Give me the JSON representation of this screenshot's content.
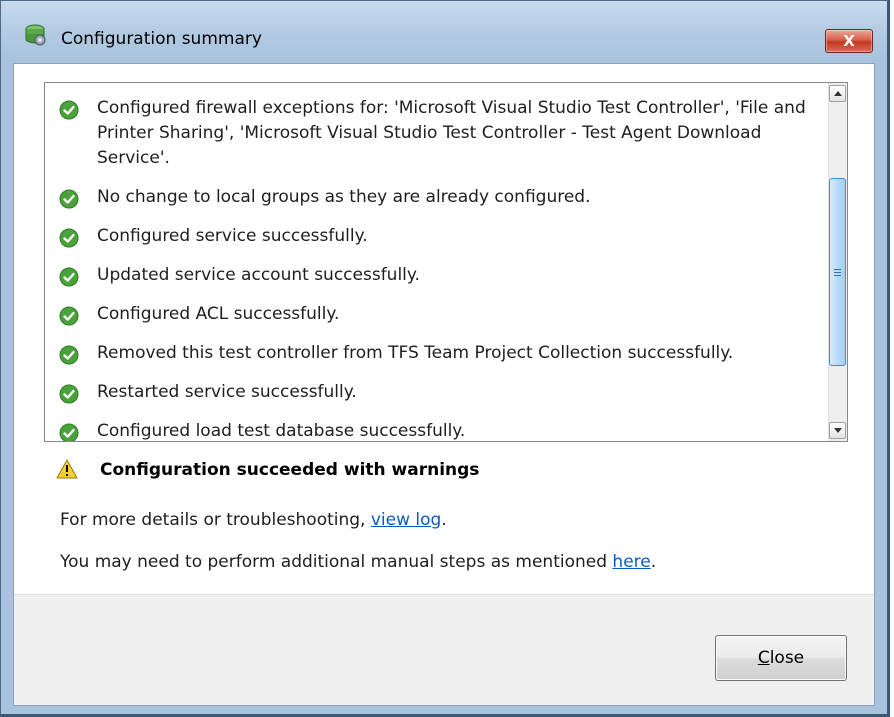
{
  "window": {
    "title": "Configuration summary",
    "close_glyph": "X",
    "app_icon": "server-config-icon"
  },
  "summary": {
    "items": [
      {
        "icon": "check-circle-icon",
        "text": "Configured firewall exceptions for: 'Microsoft Visual Studio Test Controller', 'File and Printer Sharing', 'Microsoft Visual Studio Test Controller - Test Agent Download Service'."
      },
      {
        "icon": "check-circle-icon",
        "text": "No change to local groups as they are already configured."
      },
      {
        "icon": "check-circle-icon",
        "text": "Configured service successfully."
      },
      {
        "icon": "check-circle-icon",
        "text": "Updated service account successfully."
      },
      {
        "icon": "check-circle-icon",
        "text": "Configured ACL successfully."
      },
      {
        "icon": "check-circle-icon",
        "text": "Removed this test controller from TFS Team Project Collection successfully."
      },
      {
        "icon": "check-circle-icon",
        "text": "Restarted service successfully."
      },
      {
        "icon": "check-circle-icon",
        "text": "Configured load test database successfully."
      }
    ]
  },
  "status": {
    "icon": "warning-triangle-icon",
    "text": "Configuration succeeded with warnings"
  },
  "details": {
    "prefix": "For more details or troubleshooting, ",
    "link": "view log",
    "suffix": "."
  },
  "manual": {
    "prefix": "You may need to perform additional manual steps as mentioned ",
    "link": "here",
    "suffix": "."
  },
  "footer": {
    "close_mnemonic": "C",
    "close_rest": "lose"
  },
  "colors": {
    "check_green": "#4aa23a",
    "warning_yellow": "#f4cf2e",
    "link_blue": "#0a5bc4",
    "title_close_red": "#c4371f"
  }
}
